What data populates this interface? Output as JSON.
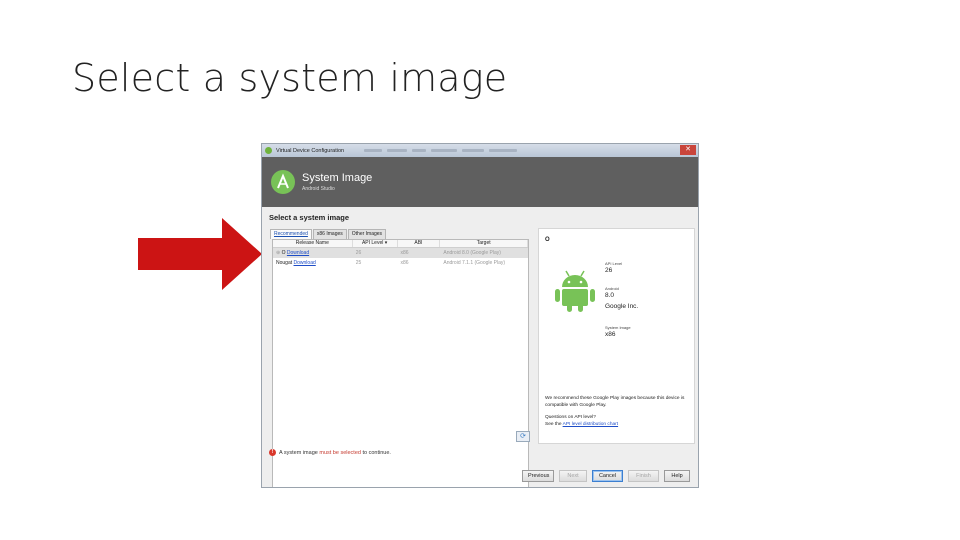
{
  "slide": {
    "title": "Select a system image"
  },
  "window": {
    "title": "Virtual Device Configuration",
    "close": "✕",
    "header": {
      "title": "System Image",
      "subtitle": "Android Studio"
    },
    "section_title": "Select a system image",
    "tabs": [
      {
        "label": "Recommended"
      },
      {
        "label": "x86 Images"
      },
      {
        "label": "Other Images"
      }
    ],
    "table": {
      "columns": [
        "Release Name",
        "API Level ▾",
        "ABI",
        "Target"
      ],
      "rows": [
        {
          "marker": "⊕",
          "name": "Download",
          "name_prefix": "O",
          "api": "26",
          "abi": "x86",
          "target": "Android 8.0 (Google Play)"
        },
        {
          "marker": "",
          "name": "Download",
          "name_prefix": "Nougat",
          "api": "25",
          "abi": "x86",
          "target": "Android 7.1.1 (Google Play)"
        }
      ]
    },
    "refresh_icon": "⟳",
    "detail": {
      "name": "O",
      "api_level_label": "API Level",
      "api_level": "26",
      "android_label": "Android",
      "android_version": "8.0",
      "vendor": "Google Inc.",
      "system_image_label": "System Image",
      "system_image": "x86",
      "note": "We recommend these Google Play images because this device is compatible with Google Play.",
      "question": "Questions on API level?",
      "see_the": "See the",
      "chart_link": "API level distribution chart"
    },
    "error": {
      "icon": "!",
      "text_a": "A system image",
      "text_b": "must be selected",
      "text_c": "to continue."
    },
    "buttons": {
      "previous": "Previous",
      "next": "Next",
      "cancel": "Cancel",
      "finish": "Finish",
      "help": "Help"
    }
  },
  "colors": {
    "arrow": "#cc1414",
    "header_bg": "#5f5f5f",
    "android_green": "#78c257"
  }
}
